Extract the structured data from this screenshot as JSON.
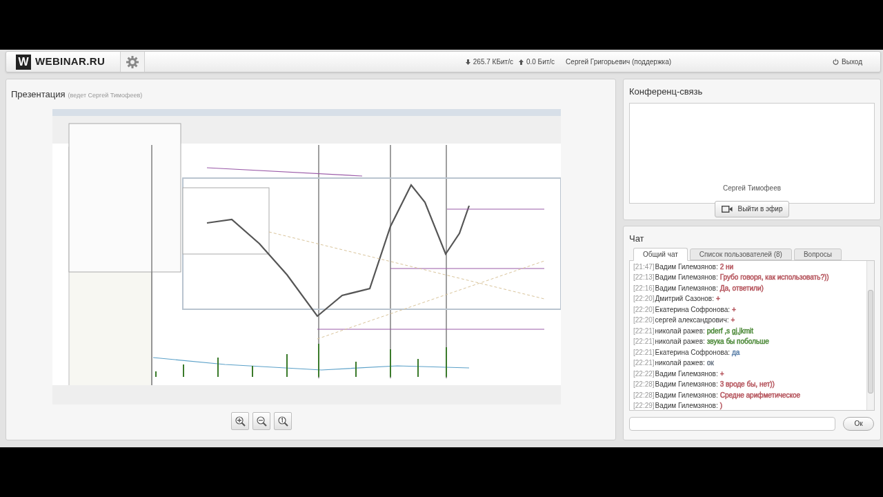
{
  "header": {
    "logo_mark": "W",
    "logo_text": "WEBINAR.RU",
    "download_speed": "265.7 КБит/с",
    "upload_speed": "0.0 Бит/с",
    "user": "Сергей Григорьевич (поддержка)",
    "logout": "Выход"
  },
  "presentation": {
    "title": "Презентация",
    "presenter": "(ведет Сергей Тимофеев)",
    "zoom_buttons": [
      {
        "kind": "zoom_in"
      },
      {
        "kind": "zoom_out"
      },
      {
        "kind": "actual_size"
      }
    ]
  },
  "conference": {
    "title": "Конференц-связь",
    "participant": "Сергей Тимофеев",
    "broadcast_button": "Выйти в эфир"
  },
  "chat": {
    "title": "Чат",
    "tabs": [
      {
        "label": "Общий чат",
        "selected": true
      },
      {
        "label": "Список пользователей (8)",
        "selected": false
      },
      {
        "label": "Вопросы",
        "selected": false
      }
    ],
    "messages": [
      {
        "time": "[21:47]",
        "author": "Вадим Гилемзянов:",
        "text": "2 ни",
        "color": "#b5545c"
      },
      {
        "time": "[22:13]",
        "author": "Вадим Гилемзянов:",
        "text": "Грубо говоря, как использовать?))",
        "color": "#b5545c"
      },
      {
        "time": "[22:16]",
        "author": "Вадим Гилемзянов:",
        "text": "Да, ответили)",
        "color": "#b5545c"
      },
      {
        "time": "[22:20]",
        "author": "Дмитрий Сазонов:",
        "text": "+",
        "color": "#b5545c"
      },
      {
        "time": "[22:20]",
        "author": "Екатерина Софронова:",
        "text": "+",
        "color": "#b5545c"
      },
      {
        "time": "[22:20]",
        "author": "сергей александрович:",
        "text": "+",
        "color": "#b5545c"
      },
      {
        "time": "[22:21]",
        "author": "николай ражев:",
        "text": "pderf ,s gj,jkmit",
        "color": "#4e8a3a"
      },
      {
        "time": "[22:21]",
        "author": "николай ражев:",
        "text": "звука бы побольше",
        "color": "#4e8a3a"
      },
      {
        "time": "[22:21]",
        "author": "Екатерина Софронова:",
        "text": "да",
        "color": "#5a7fa8"
      },
      {
        "time": "[22:21]",
        "author": "николай ражев:",
        "text": "ок",
        "color": "#6b7785"
      },
      {
        "time": "[22:22]",
        "author": "Вадим Гилемзянов:",
        "text": "+",
        "color": "#b5545c"
      },
      {
        "time": "[22:28]",
        "author": "Вадим Гилемзянов:",
        "text": "3 вроде бы, нет))",
        "color": "#b5545c"
      },
      {
        "time": "[22:28]",
        "author": "Вадим Гилемзянов:",
        "text": "Средне арифметическое",
        "color": "#b5545c"
      },
      {
        "time": "[22:29]",
        "author": "Вадим Гилемзянов:",
        "text": ")",
        "color": "#b5545c"
      }
    ],
    "send_button": "Ок"
  }
}
